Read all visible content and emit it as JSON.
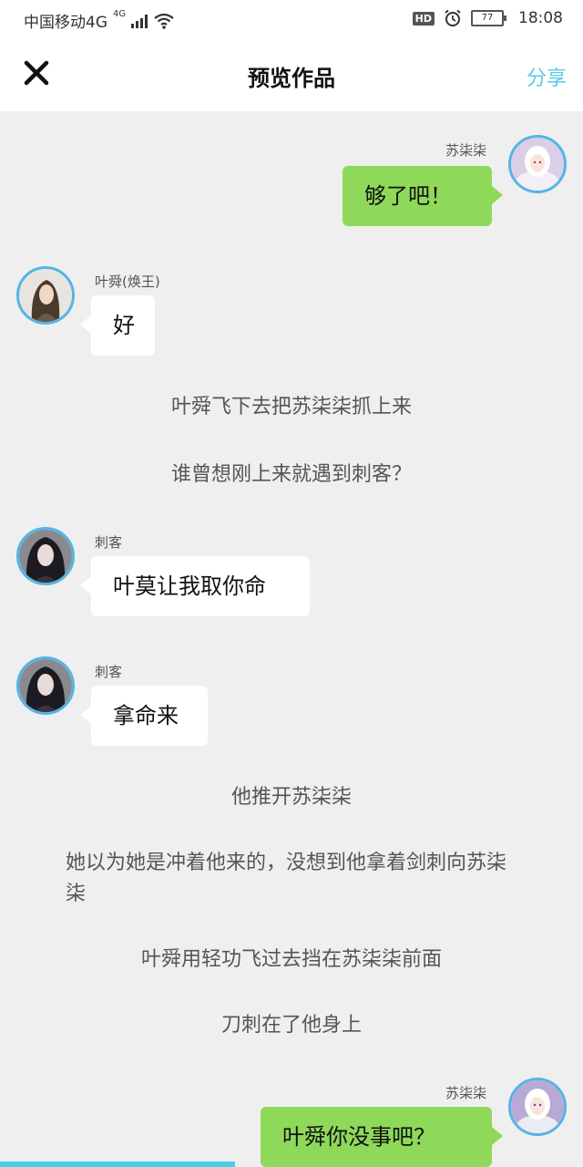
{
  "status_bar": {
    "carrier": "中国移动4G",
    "network_badge": "4G",
    "hd_badge": "HD",
    "battery": "77",
    "time": "18:08"
  },
  "header": {
    "title": "预览作品",
    "share_label": "分享",
    "close_icon": "close-icon"
  },
  "messages": [
    {
      "side": "right",
      "name": "苏柒柒",
      "text": "够了吧！"
    },
    {
      "side": "left",
      "name": "叶舜(焕王)",
      "text": "好"
    },
    {
      "type": "narration",
      "text": "叶舜飞下去把苏柒柒抓上来"
    },
    {
      "type": "narration",
      "text": "谁曾想刚上来就遇到刺客？"
    },
    {
      "side": "left",
      "name": "刺客",
      "text": "叶莫让我取你命"
    },
    {
      "side": "left",
      "name": "刺客",
      "text": "拿命来"
    },
    {
      "type": "narration",
      "text": "他推开苏柒柒"
    },
    {
      "type": "narration",
      "text": "她以为她是冲着他来的，没想到他拿着剑刺向苏柒柒"
    },
    {
      "type": "narration",
      "text": "叶舜用轻功飞过去挡在苏柒柒前面"
    },
    {
      "type": "narration",
      "text": "刀刺在了他身上"
    },
    {
      "side": "right",
      "name": "苏柒柒",
      "text": "叶舜你没事吧？"
    }
  ],
  "colors": {
    "accent": "#5bc9e6",
    "avatar_border": "#54b4e6",
    "green_bubble": "#8fd95a",
    "background": "#efefef",
    "progress": "#48d0e6"
  }
}
